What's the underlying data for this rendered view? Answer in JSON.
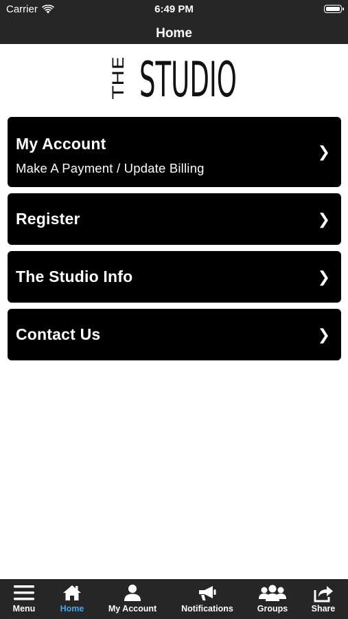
{
  "status_bar": {
    "carrier": "Carrier",
    "time": "6:49 PM"
  },
  "nav": {
    "title": "Home"
  },
  "logo": {
    "line1": "THE",
    "line2": "STUDIO"
  },
  "menu_items": [
    {
      "title": "My Account",
      "subtitle": "Make A Payment / Update Billing",
      "chevron": "❯"
    },
    {
      "title": "Register",
      "chevron": "❯"
    },
    {
      "title": "The Studio Info",
      "chevron": "❯"
    },
    {
      "title": "Contact Us",
      "chevron": "❯"
    }
  ],
  "tabbar": {
    "active_color": "#4aa3e6",
    "tabs": [
      {
        "label": "Menu",
        "icon": "hamburger-icon"
      },
      {
        "label": "Home",
        "icon": "home-icon",
        "active": true
      },
      {
        "label": "My Account",
        "icon": "person-icon"
      },
      {
        "label": "Notifications",
        "icon": "megaphone-icon"
      },
      {
        "label": "Groups",
        "icon": "group-icon"
      },
      {
        "label": "Share",
        "icon": "share-icon"
      }
    ]
  },
  "colors": {
    "bar_background": "#262626",
    "card_background": "#000000",
    "page_background": "#ffffff"
  }
}
